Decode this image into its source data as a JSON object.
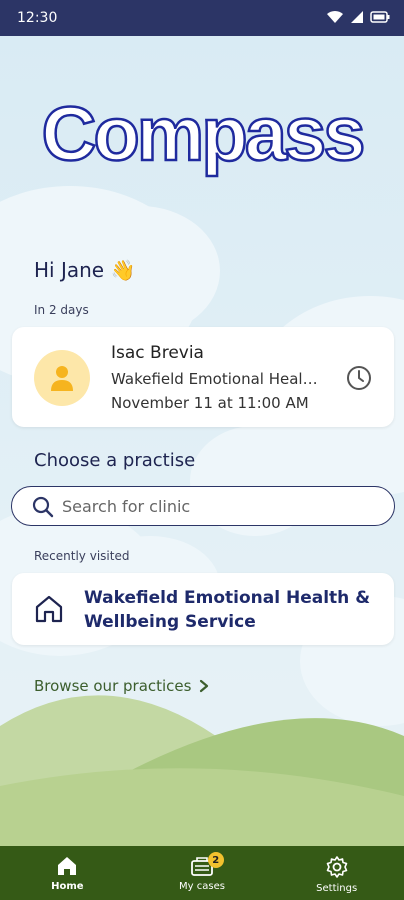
{
  "status_bar": {
    "time": "12:30"
  },
  "app": {
    "name": "Compass"
  },
  "greeting": {
    "text": "Hi Jane",
    "emoji": "👋"
  },
  "upcoming": {
    "label": "In 2 days",
    "name": "Isac Brevia",
    "clinic": "Wakefield Emotional Health & Wellbeing Service",
    "date": "November 11 at 11:00 AM"
  },
  "practise": {
    "title": "Choose a practise",
    "search_placeholder": "Search for clinic",
    "recent_label": "Recently visited",
    "recent_items": [
      {
        "name": "Wakefield Emotional Health & Wellbeing Service"
      }
    ],
    "browse_label": "Browse our practices"
  },
  "nav": {
    "items": [
      {
        "label": "Home",
        "icon": "home-icon"
      },
      {
        "label": "My cases",
        "icon": "cases-icon",
        "badge": "2"
      },
      {
        "label": "Settings",
        "icon": "gear-icon"
      }
    ]
  },
  "colors": {
    "status_bar": "#2c3566",
    "navy": "#1e2450",
    "nav_green": "#355a16",
    "avatar_bg": "#fde7a9",
    "badge": "#f2c12e"
  }
}
